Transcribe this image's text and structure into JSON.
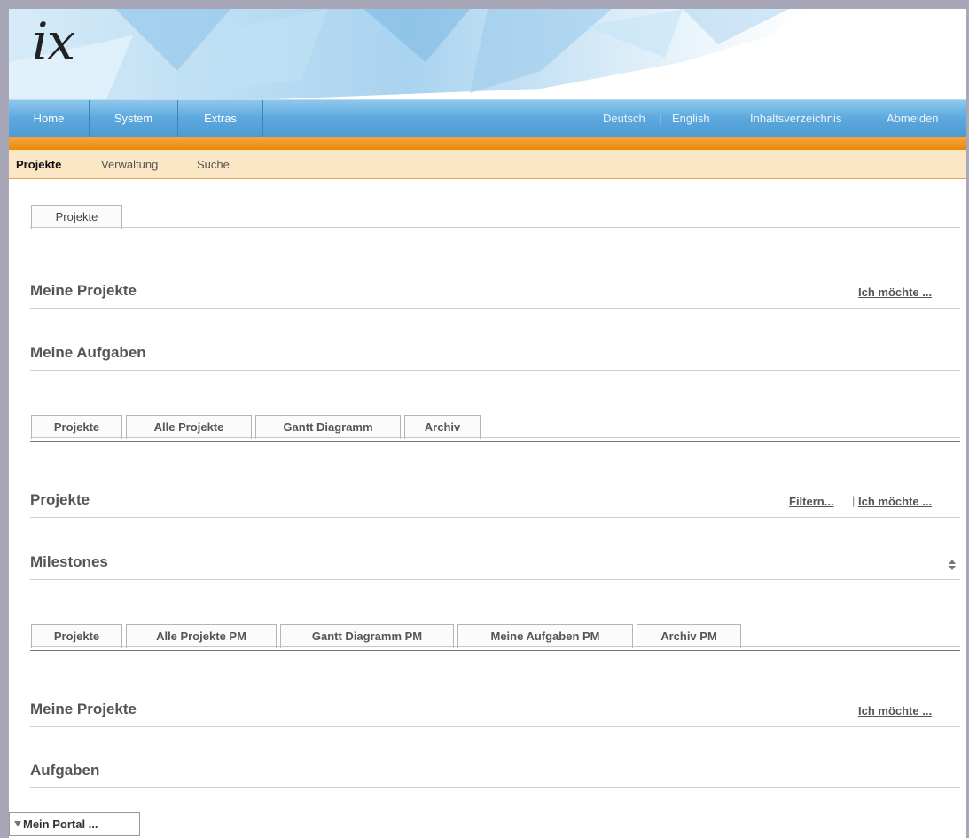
{
  "brand": {
    "logo_text": "ix"
  },
  "topnav": {
    "tabs": [
      "Home",
      "System",
      "Extras"
    ],
    "lang_de": "Deutsch",
    "lang_sep": "|",
    "lang_en": "English",
    "toc": "Inhaltsverzeichnis",
    "logout": "Abmelden"
  },
  "subnav": {
    "items": [
      "Projekte",
      "Verwaltung",
      "Suche"
    ],
    "active": "Projekte"
  },
  "tabs1": [
    "Projekte"
  ],
  "section1": {
    "title": "Meine Projekte",
    "action": "Ich möchte ..."
  },
  "section2": {
    "title": "Meine Aufgaben"
  },
  "tabs2": [
    "Projekte",
    "Alle Projekte",
    "Gantt Diagramm",
    "Archiv"
  ],
  "section3": {
    "title": "Projekte",
    "filter": "Filtern...",
    "sep": "|",
    "action": "Ich möchte ..."
  },
  "section4": {
    "title": "Milestones",
    "icon": "sort-icon"
  },
  "tabs3": [
    "Projekte",
    "Alle Projekte PM",
    "Gantt Diagramm PM",
    "Meine Aufgaben PM",
    "Archiv PM"
  ],
  "section5": {
    "title": "Meine Projekte",
    "action": "Ich möchte ..."
  },
  "section6": {
    "title": "Aufgaben"
  },
  "portal": {
    "label": "Mein Portal ...",
    "icon": "triangle-down-icon"
  },
  "colors": {
    "nav_blue": "#5eaadf",
    "orange": "#f29b25",
    "subnav_bg": "#fbe7c6"
  }
}
